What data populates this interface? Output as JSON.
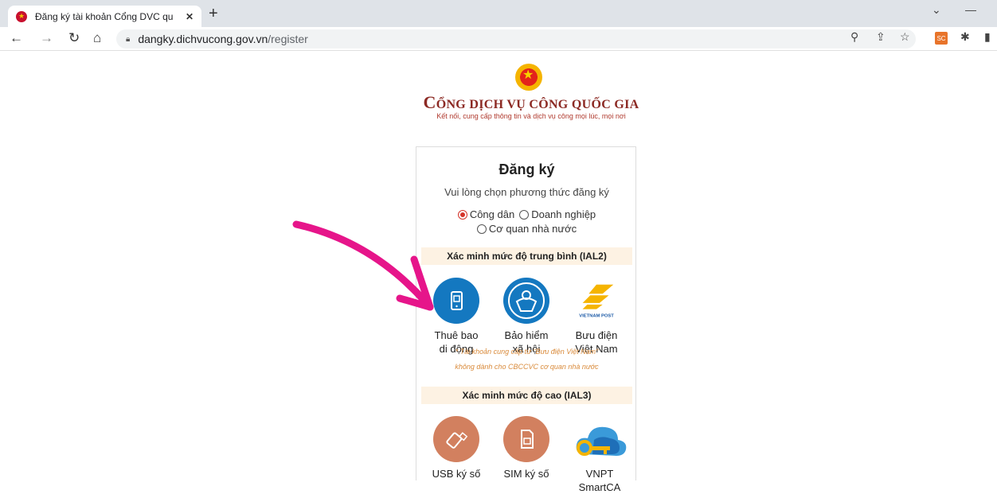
{
  "browser": {
    "tab_title": "Đăng ký tài khoản Cổng DVC qu",
    "tab_close": "✕",
    "new_tab": "+",
    "url_host": "dangky.dichvucong.gov.vn",
    "url_path": "/register",
    "ext_label": "SC"
  },
  "header": {
    "title_prefix": "C",
    "title_rest": "ỔNG DỊCH VỤ CÔNG QUỐC GIA",
    "tagline": "Kết nối, cung cấp thông tin và dịch vụ công mọi lúc, mọi nơi"
  },
  "register": {
    "title": "Đăng ký",
    "subtitle": "Vui lòng chọn phương thức đăng ký",
    "radio_citizen": "Công dân",
    "radio_business": "Doanh nghiệp",
    "radio_agency": "Cơ quan nhà nước",
    "selected": "citizen",
    "ial2_title": "Xác minh mức độ trung bình (IAL2)",
    "ial2_options": [
      {
        "line1": "Thuê bao",
        "line2": "di động"
      },
      {
        "line1": "Bảo hiểm",
        "line2": "xã hội"
      },
      {
        "line1": "Bưu điện",
        "line2": "Việt Nam"
      }
    ],
    "vnpost_logo_text": "VIETNAM POST",
    "note_line1": "* Tài khoản cung cấp từ \"Bưu điện Việt Nam\"",
    "note_line2": "không dành cho CBCCVC cơ quan nhà nước",
    "ial3_title": "Xác minh mức độ cao (IAL3)",
    "ial3_options": [
      {
        "label": "USB ký số"
      },
      {
        "label": "SIM ký số"
      },
      {
        "label": "VNPT SmartCA"
      }
    ]
  },
  "colors": {
    "accent": "#d4342a",
    "mobile_blue": "#1478c0",
    "usb_orange": "#d2805f",
    "annotation_arrow": "#e6158a"
  }
}
